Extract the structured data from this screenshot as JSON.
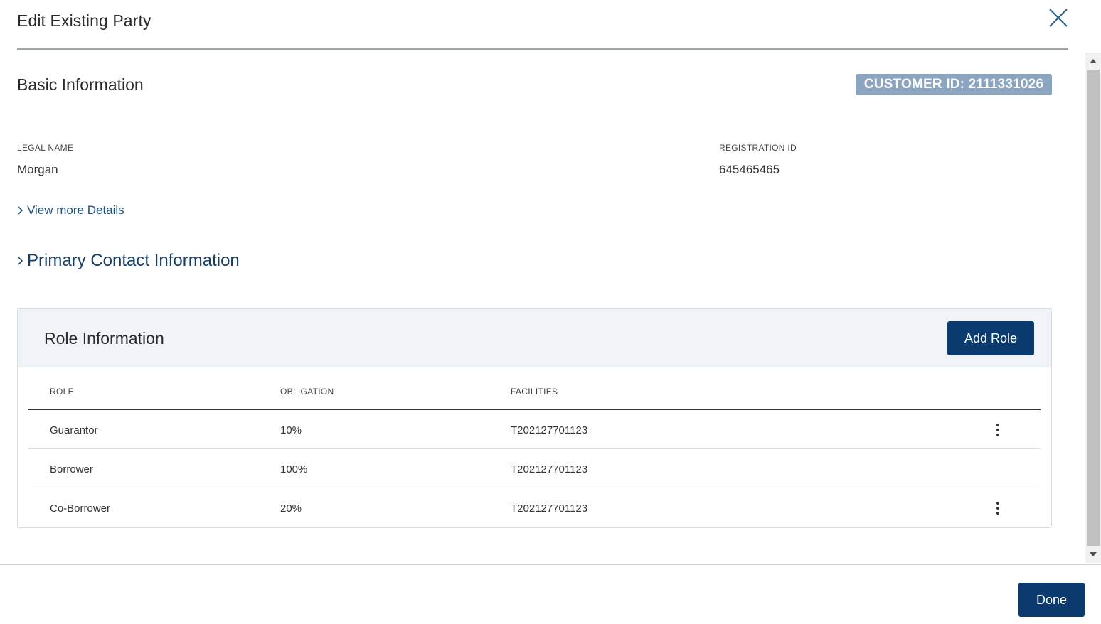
{
  "modal": {
    "title": "Edit Existing Party"
  },
  "basic_info": {
    "title": "Basic Information",
    "customer_id": "CUSTOMER ID: 2111331026",
    "legal_name_label": "LEGAL NAME",
    "legal_name_value": "Morgan",
    "registration_id_label": "REGISTRATION ID",
    "registration_id_value": "645465465",
    "view_more_label": "View more Details"
  },
  "primary_contact": {
    "label": "Primary Contact Information"
  },
  "role_info": {
    "title": "Role Information",
    "add_role_label": "Add Role",
    "columns": [
      "ROLE",
      "OBLIGATION",
      "FACILITIES"
    ],
    "rows": [
      {
        "role": "Guarantor",
        "obligation": "10%",
        "facilities": "T202127701123",
        "has_menu": true
      },
      {
        "role": "Borrower",
        "obligation": "100%",
        "facilities": "T202127701123",
        "has_menu": false
      },
      {
        "role": "Co-Borrower",
        "obligation": "20%",
        "facilities": "T202127701123",
        "has_menu": true
      }
    ]
  },
  "footer": {
    "done_label": "Done"
  },
  "colors": {
    "primary_button": "#0a3a6e",
    "badge": "#8ba4c0",
    "link": "#1f4e79",
    "card_header": "#f0f4f8"
  },
  "icons": {
    "close": "close-icon",
    "chevron": "chevron-right-icon",
    "row_menu": "kebab-menu-icon"
  }
}
